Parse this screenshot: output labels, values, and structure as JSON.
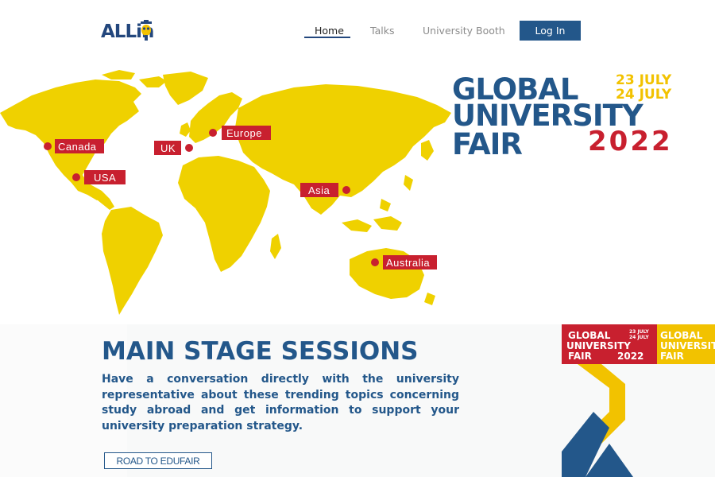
{
  "header": {
    "logo_text": "ALLin",
    "nav": {
      "home": "Home",
      "talks": "Talks",
      "booth": "University Booth"
    },
    "login_label": "Log In"
  },
  "hero": {
    "map_pins": [
      "Canada",
      "USA",
      "UK",
      "Europe",
      "Asia",
      "Australia"
    ],
    "fair_title": {
      "line1": "GLOBAL",
      "line2": "UNIVERSITY",
      "line3": "FAIR",
      "date1": "23 JULY",
      "date2": "24 JULY",
      "year": "2022"
    }
  },
  "sessions": {
    "title": "MAIN STAGE SESSIONS",
    "description": "Have a conversation directly with the university representative about these trending topics concerning study abroad and get information to support your university preparation strategy.",
    "button_label": "ROAD TO EDUFAIR"
  },
  "ribbon": {
    "line1": "GLOBAL",
    "line2": "UNIVERSITY",
    "line3": "FAIR",
    "date1": "23 JULY",
    "date2": "24 JULY",
    "year": "2022"
  },
  "colors": {
    "brand_blue": "#23578a",
    "accent_yellow": "#f2c200",
    "accent_red": "#c8202f",
    "map_yellow": "#efd100"
  }
}
